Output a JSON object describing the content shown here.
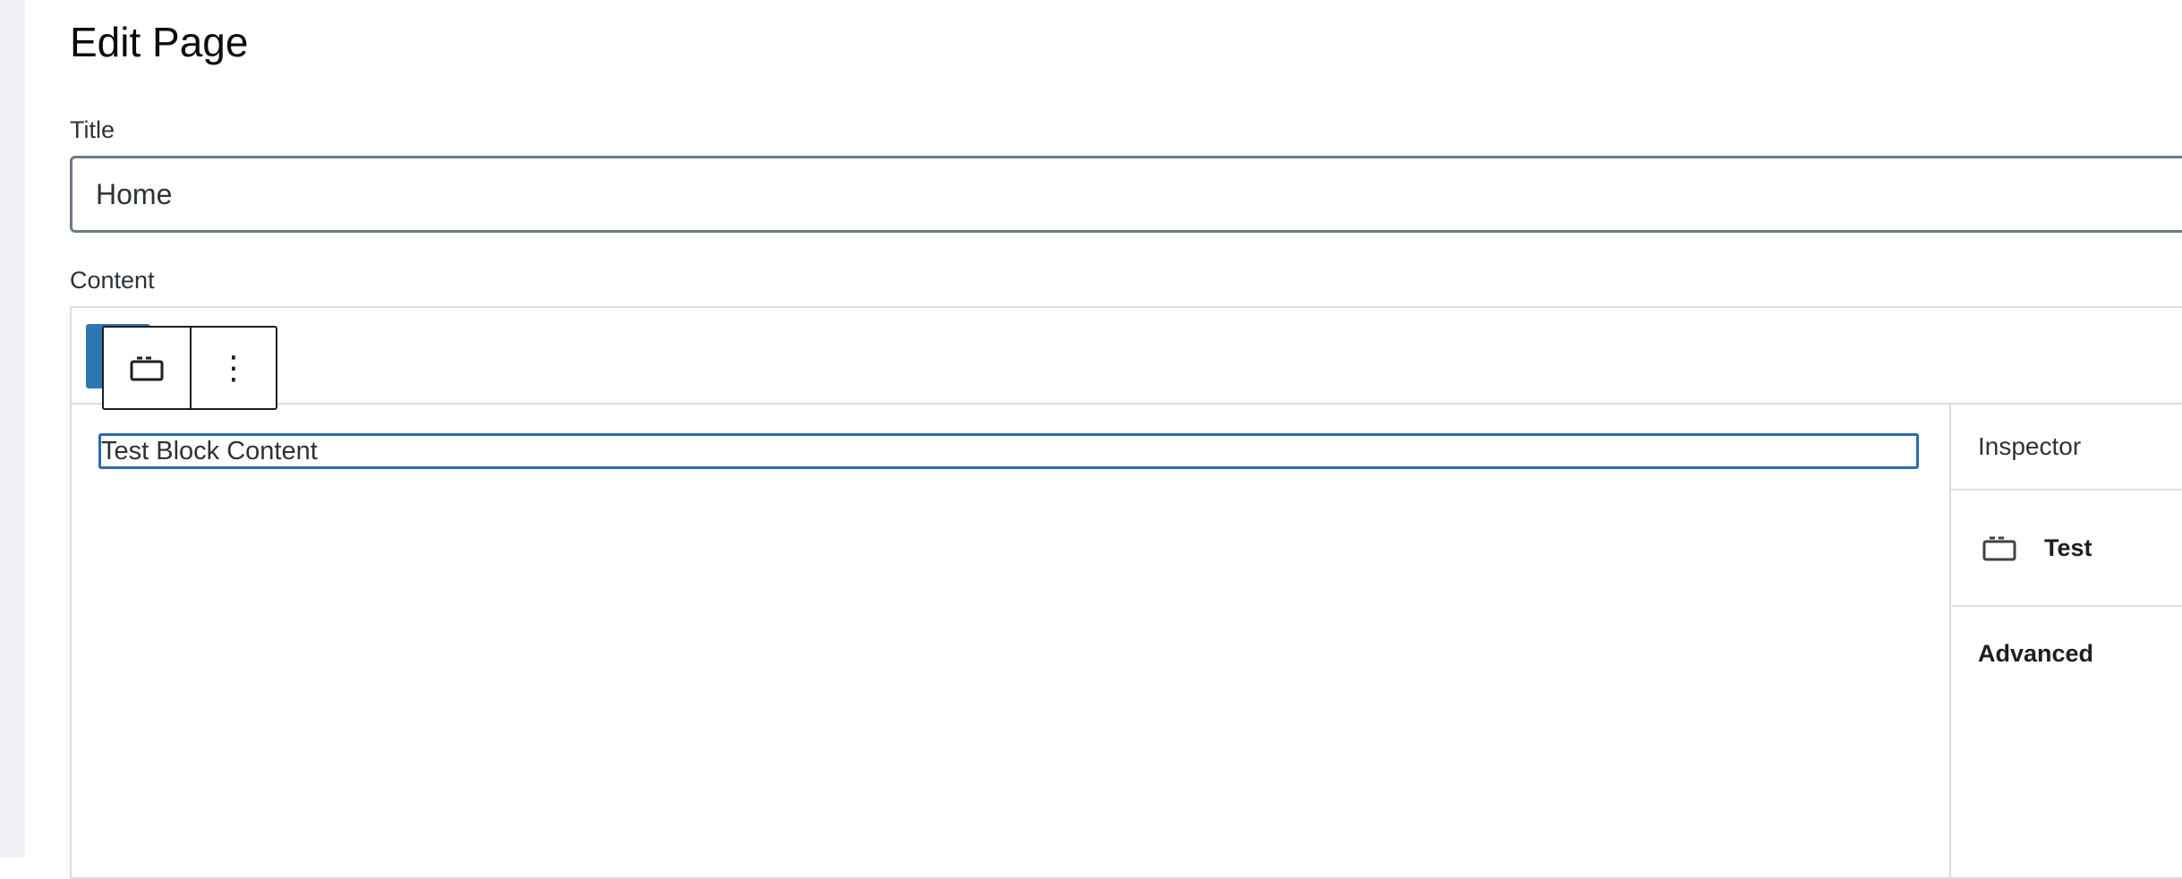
{
  "page": {
    "title": "Edit Page"
  },
  "form": {
    "title_label": "Title",
    "title_value": "Home",
    "content_label": "Content"
  },
  "editor": {
    "block_toolbar": {
      "block_type_icon": "block-default-icon",
      "options_icon": "more-vertical-icon",
      "options_glyph": "⋮"
    },
    "block": {
      "text": "Test Block Content"
    },
    "inspector": {
      "header": "Inspector",
      "block_icon": "block-default-icon",
      "block_name": "Test",
      "advanced_label": "Advanced"
    }
  },
  "colors": {
    "accent": "#2f77b3",
    "block_border": "#2b6cb0",
    "left_rail": "#f0f0f6"
  }
}
